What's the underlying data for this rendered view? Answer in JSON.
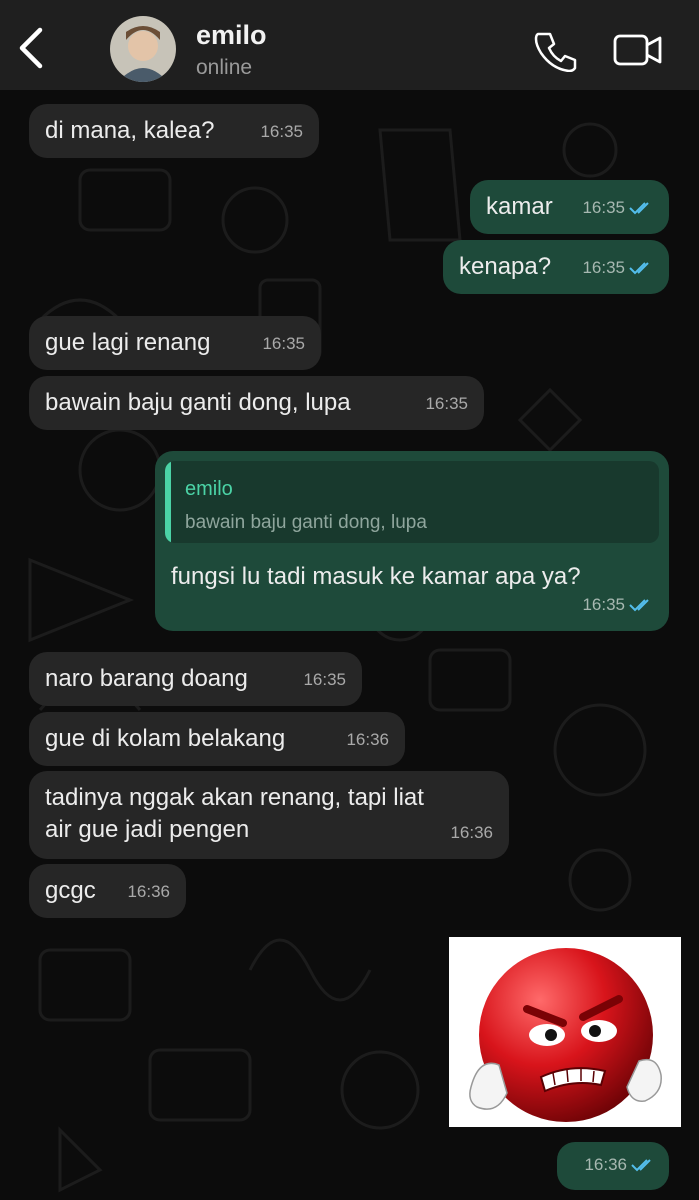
{
  "header": {
    "contact_name": "emilo",
    "status": "online"
  },
  "icons": {
    "back": "chevron-left-icon",
    "call": "phone-icon",
    "video": "video-camera-icon",
    "read_receipt": "double-check-icon"
  },
  "colors": {
    "header_bg": "#1f1f1f",
    "incoming_bubble": "#262626",
    "outgoing_bubble": "#1e4a3a",
    "quote_accent": "#4bd3a6",
    "read_tick": "#53bdeb"
  },
  "messages": [
    {
      "direction": "in",
      "text": "di mana, kalea?",
      "time": "16:35"
    },
    {
      "direction": "out",
      "text": "kamar",
      "time": "16:35",
      "read": true
    },
    {
      "direction": "out",
      "text": "kenapa?",
      "time": "16:35",
      "read": true
    },
    {
      "direction": "in",
      "text": "gue lagi renang",
      "time": "16:35"
    },
    {
      "direction": "in",
      "text": "bawain baju ganti dong, lupa",
      "time": "16:35"
    },
    {
      "direction": "out",
      "reply_to": {
        "name": "emilo",
        "text": "bawain baju ganti dong, lupa"
      },
      "text": "fungsi lu tadi masuk ke kamar apa ya?",
      "time": "16:35",
      "read": true
    },
    {
      "direction": "in",
      "text": "naro barang doang",
      "time": "16:35"
    },
    {
      "direction": "in",
      "text": "gue di kolam belakang",
      "time": "16:36"
    },
    {
      "direction": "in",
      "text_lines": [
        "tadinya nggak akan renang, tapi liat",
        "air gue jadi pengen"
      ],
      "time": "16:36"
    },
    {
      "direction": "in",
      "text": "gcgc",
      "time": "16:36"
    },
    {
      "direction": "out",
      "type": "sticker",
      "sticker": "angry-red-face-emoji"
    },
    {
      "direction": "out",
      "text": "",
      "time": "16:36",
      "read": true
    }
  ]
}
